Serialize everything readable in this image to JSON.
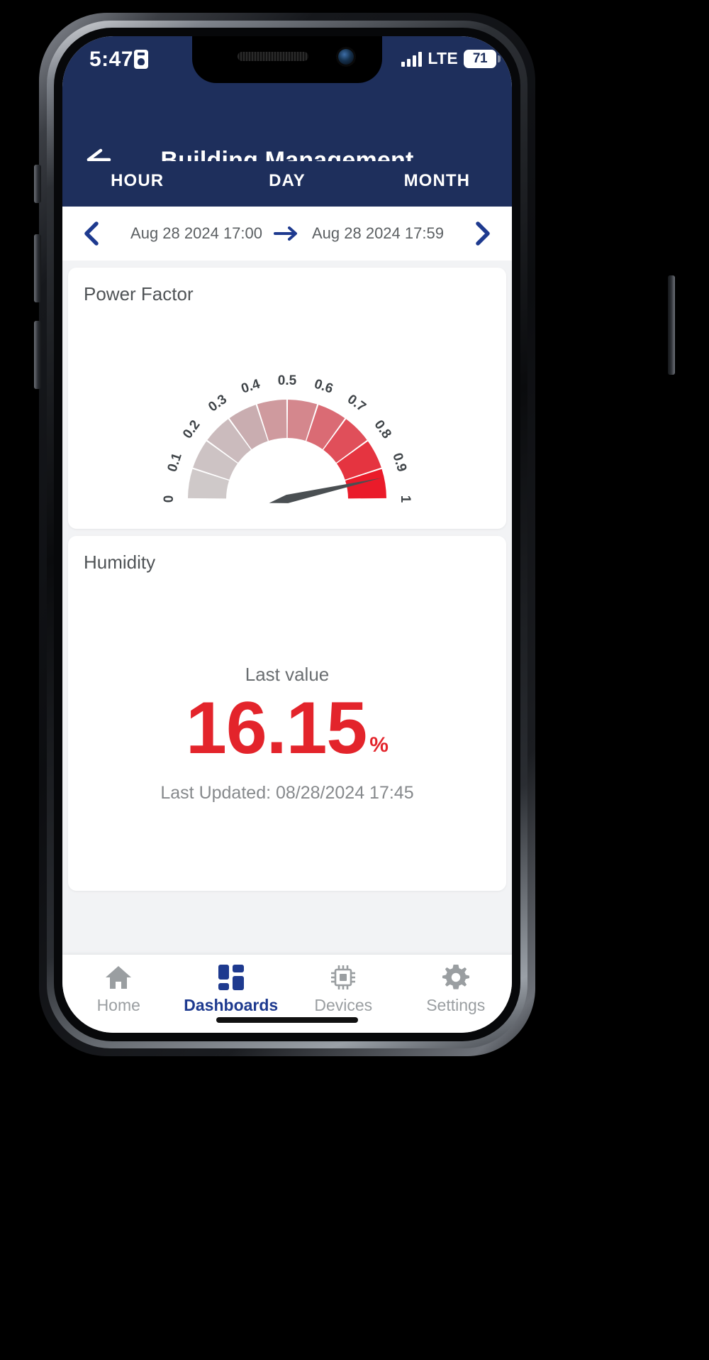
{
  "status_bar": {
    "time": "5:47",
    "id_icon": "id-badge-icon",
    "network": "LTE",
    "battery_level": "71",
    "signal_icon": "signal-bars-icon"
  },
  "app_bar": {
    "back_icon": "back-arrow-icon",
    "title": "Building Management"
  },
  "tabs": [
    {
      "label": "HOUR",
      "active": true
    },
    {
      "label": "DAY",
      "active": false
    },
    {
      "label": "MONTH",
      "active": false
    }
  ],
  "date_nav": {
    "prev_icon": "chevron-left-icon",
    "next_icon": "chevron-right-icon",
    "arrow_icon": "arrow-right-icon",
    "start": "Aug 28 2024 17:00",
    "end": "Aug 28 2024 17:59"
  },
  "cards": {
    "gauge": {
      "title": "Power Factor"
    },
    "humidity": {
      "title": "Humidity",
      "last_value_label": "Last value",
      "value": "16.15",
      "unit": "%",
      "last_updated": "Last Updated: 08/28/2024 17:45"
    }
  },
  "bottom_nav": [
    {
      "label": "Home",
      "icon": "home-icon",
      "active": false
    },
    {
      "label": "Dashboards",
      "icon": "dashboards-grid-icon",
      "active": true
    },
    {
      "label": "Devices",
      "icon": "chip-icon",
      "active": false
    },
    {
      "label": "Settings",
      "icon": "gear-icon",
      "active": false
    }
  ],
  "colors": {
    "header_blue": "#1e2f5c",
    "accent_blue": "#1e3a8f",
    "value_red": "#e3242b",
    "page_bg": "#f2f3f5"
  },
  "chart_data": {
    "type": "gauge",
    "title": "Power Factor",
    "min": 0,
    "max": 1,
    "value": 0.93,
    "tick_labels": [
      "0",
      "0.1",
      "0.2",
      "0.3",
      "0.4",
      "0.5",
      "0.6",
      "0.7",
      "0.8",
      "0.9",
      "1"
    ],
    "tick_values": [
      0,
      0.1,
      0.2,
      0.3,
      0.4,
      0.5,
      0.6,
      0.7,
      0.8,
      0.9,
      1
    ],
    "segments": [
      {
        "from": 0.0,
        "to": 0.1,
        "color": "#cfc9c9"
      },
      {
        "from": 0.1,
        "to": 0.2,
        "color": "#cdc3c4"
      },
      {
        "from": 0.2,
        "to": 0.3,
        "color": "#cbbbbd"
      },
      {
        "from": 0.3,
        "to": 0.4,
        "color": "#c9adb0"
      },
      {
        "from": 0.4,
        "to": 0.5,
        "color": "#cf9a9e"
      },
      {
        "from": 0.5,
        "to": 0.6,
        "color": "#d4878d"
      },
      {
        "from": 0.6,
        "to": 0.7,
        "color": "#da6b74"
      },
      {
        "from": 0.7,
        "to": 0.8,
        "color": "#e04f5a"
      },
      {
        "from": 0.8,
        "to": 0.9,
        "color": "#e53440"
      },
      {
        "from": 0.9,
        "to": 1.0,
        "color": "#ea1b2a"
      }
    ],
    "needle_color": "#4a4f52",
    "grid": false,
    "legend": "none"
  }
}
